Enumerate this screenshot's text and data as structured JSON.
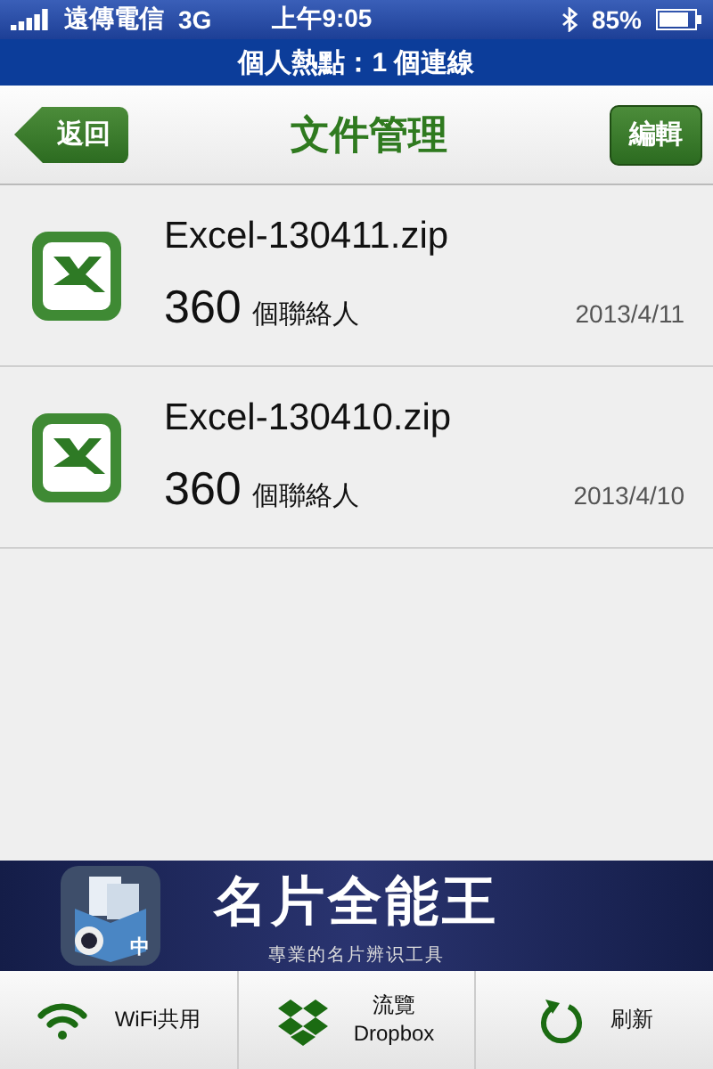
{
  "status_bar": {
    "carrier": "遠傳電信",
    "network": "3G",
    "time": "上午9:05",
    "battery": "85%"
  },
  "hotspot_bar": {
    "text": "個人熱點：1 個連線"
  },
  "nav": {
    "back": "返回",
    "title": "文件管理",
    "edit": "編輯"
  },
  "files": [
    {
      "name": "Excel-130411.zip",
      "count": "360",
      "count_label": "個聯絡人",
      "date": "2013/4/11"
    },
    {
      "name": "Excel-130410.zip",
      "count": "360",
      "count_label": "個聯絡人",
      "date": "2013/4/10"
    }
  ],
  "ad": {
    "badge": "中",
    "title": "名片全能王",
    "subtitle": "專業的名片辨识工具"
  },
  "toolbar": [
    {
      "kind": "wifi",
      "label": "WiFi共用"
    },
    {
      "kind": "dropbox",
      "label": "流覽",
      "label2": "Dropbox"
    },
    {
      "kind": "refresh",
      "label": "刷新"
    }
  ]
}
